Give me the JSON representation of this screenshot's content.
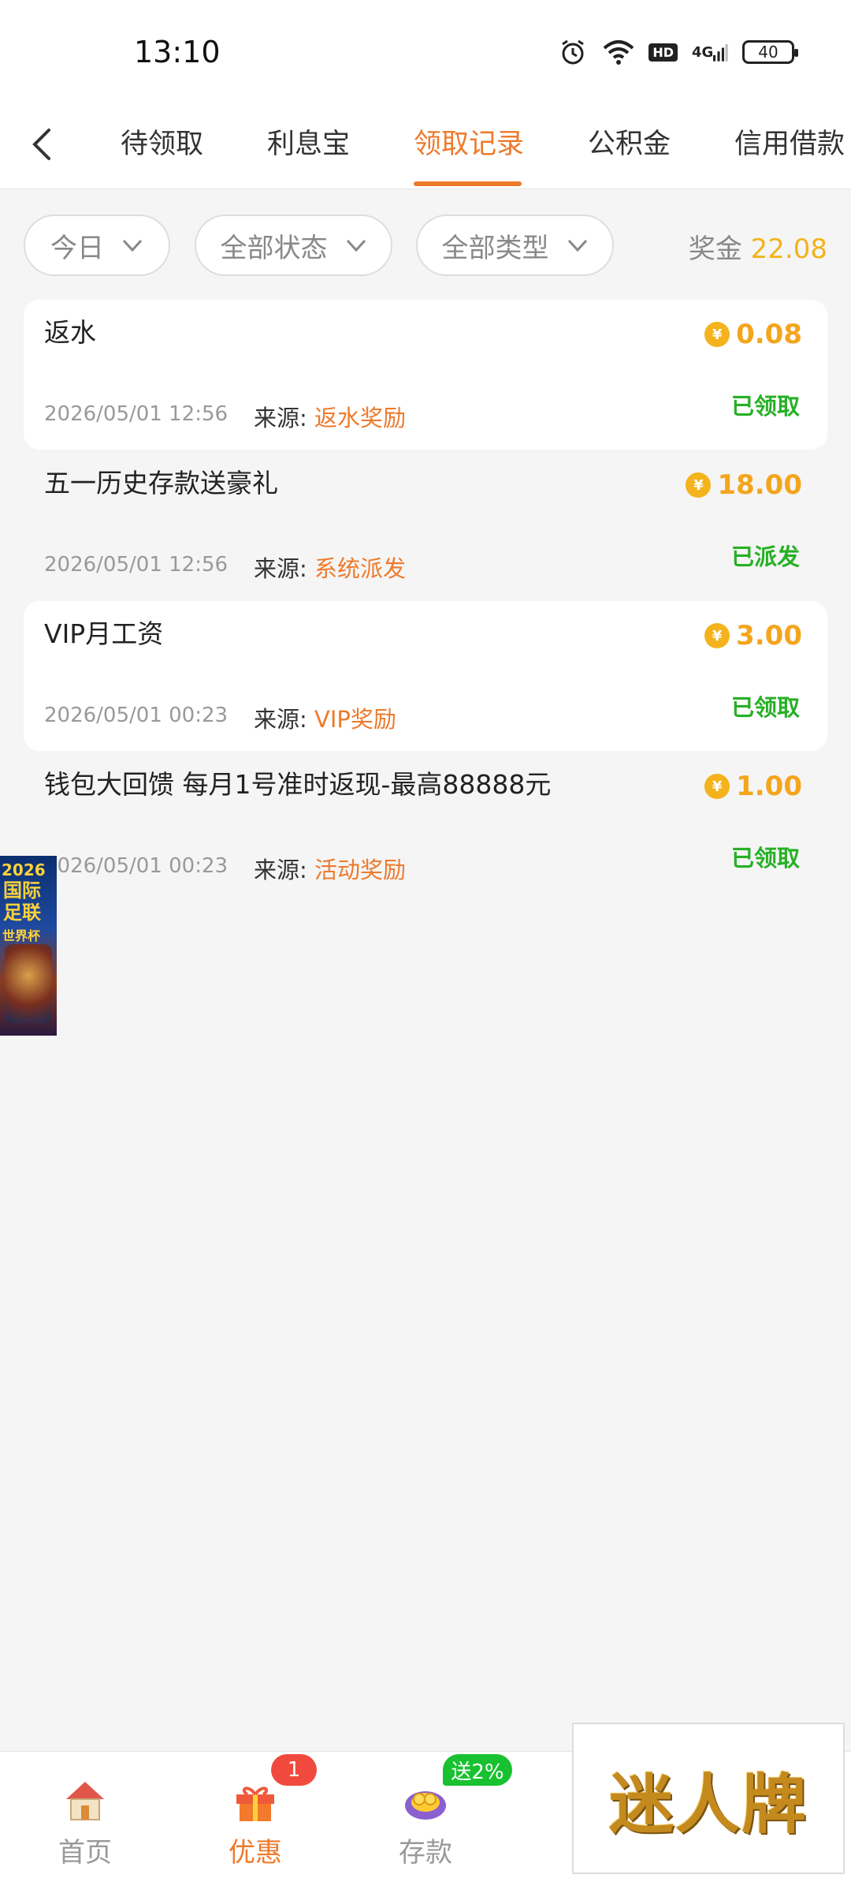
{
  "status_bar": {
    "time": "13:10",
    "network": "4G",
    "hd": "HD",
    "battery": "40",
    "icons": [
      "alarm-icon",
      "wifi-icon",
      "hd-icon",
      "signal-icon",
      "battery-icon"
    ]
  },
  "header": {
    "back_icon": "chevron-left-icon",
    "tabs": [
      {
        "label": "待领取",
        "active": false
      },
      {
        "label": "利息宝",
        "active": false
      },
      {
        "label": "领取记录",
        "active": true
      },
      {
        "label": "公积金",
        "active": false
      },
      {
        "label": "信用借款",
        "active": false
      }
    ]
  },
  "filters": {
    "date": "今日",
    "status": "全部状态",
    "type": "全部类型",
    "bonus_label": "奖金",
    "bonus_value": "22.08"
  },
  "records": [
    {
      "title": "返水",
      "amount": "0.08",
      "date": "2026/05/01 12:56",
      "source_label": "来源:",
      "source": "返水奖励",
      "status": "已领取"
    },
    {
      "title": "五一历史存款送豪礼",
      "amount": "18.00",
      "date": "2026/05/01 12:56",
      "source_label": "来源:",
      "source": "系统派发",
      "status": "已派发"
    },
    {
      "title": "VIP月工资",
      "amount": "3.00",
      "date": "2026/05/01 00:23",
      "source_label": "来源:",
      "source": "VIP奖励",
      "status": "已领取"
    },
    {
      "title": "钱包大回馈 每月1号准时返现-最高88888元",
      "amount": "1.00",
      "date": "2026/05/01 00:23",
      "source_label": "来源:",
      "source": "活动奖励",
      "status": "已领取"
    }
  ],
  "float_banner": {
    "year": "2026",
    "title": "国际足联",
    "subtitle": "世界杯"
  },
  "bottom_nav": {
    "items": [
      {
        "label": "首页",
        "icon": "house-icon"
      },
      {
        "label": "优惠",
        "icon": "gift-icon"
      },
      {
        "label": "存款",
        "icon": "coins-icon"
      }
    ],
    "promo_badge_count": "1",
    "deposit_badge": "送2%"
  },
  "ad_overlay": {
    "text": "迷人牌"
  },
  "colors": {
    "accent": "#ee7a2c",
    "amount": "#f4a51c",
    "status_ok": "#27b026",
    "badge_red": "#f04a3e",
    "badge_green": "#18c12f"
  }
}
